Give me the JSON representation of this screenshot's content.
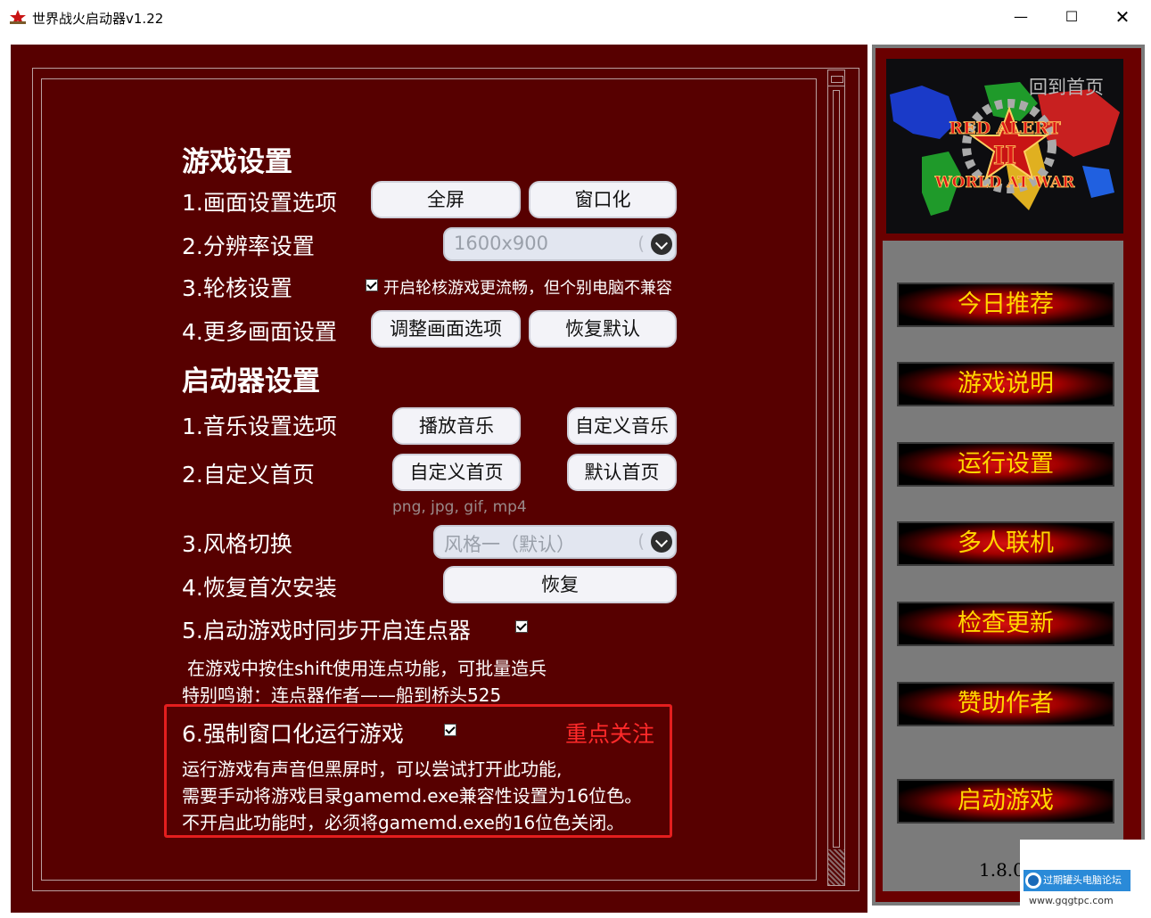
{
  "window": {
    "title": "世界战火启动器v1.22",
    "minimize": "—",
    "maximize": "☐",
    "close": "✕"
  },
  "game_settings": {
    "heading": "游戏设置",
    "display": {
      "label": "1.画面设置选项",
      "fullscreen": "全屏",
      "windowed": "窗口化"
    },
    "resolution": {
      "label": "2.分辨率设置",
      "value": "1600x900",
      "bracket": "("
    },
    "wheel": {
      "label": "3.轮核设置",
      "checkbox_text": "开启轮核游戏更流畅，但个别电脑不兼容",
      "checked": true
    },
    "more": {
      "label": "4.更多画面设置",
      "adjust": "调整画面选项",
      "restore_default": "恢复默认"
    }
  },
  "launcher_settings": {
    "heading": "启动器设置",
    "music": {
      "label": "1.音乐设置选项",
      "play": "播放音乐",
      "custom": "自定义音乐"
    },
    "homepage": {
      "label": "2.自定义首页",
      "custom": "自定义首页",
      "default": "默认首页",
      "formats": "png, jpg, gif, mp4"
    },
    "style": {
      "label": "3.风格切换",
      "value": "风格一（默认）",
      "bracket": "("
    },
    "reinstall": {
      "label": "4.恢复首次安装",
      "button": "恢复"
    },
    "autoclicker": {
      "label": "5.启动游戏时同步开启连点器",
      "checked": true,
      "note1": "在游戏中按住shift使用连点功能，可批量造兵",
      "note2": "特别鸣谢：连点器作者——船到桥头525"
    },
    "force_window": {
      "label": "6.强制窗口化运行游戏",
      "checked": true,
      "highlight": "重点关注",
      "line1": "运行游戏有声音但黑屏时，可以尝试打开此功能,",
      "line2": "需要手动将游戏目录gamemd.exe兼容性设置为16位色。",
      "line3": "不开启此功能时，必须将gamemd.exe的16位色关闭。"
    }
  },
  "sidebar": {
    "banner_text": {
      "title1": "RED ALERT",
      "title2": "II",
      "title3": "WORLD AT WAR"
    },
    "home": "回到首页",
    "buttons": [
      "今日推荐",
      "游戏说明",
      "运行设置",
      "多人联机",
      "检查更新",
      "赞助作者",
      "启动游戏"
    ],
    "version": "1.8.0"
  },
  "watermark": {
    "name": "过期罐头电脑论坛",
    "url": "www.gqgtpc.com"
  },
  "colors": {
    "panel": "#570000",
    "accent_red": "#e41e1e",
    "gold": "#ffd700"
  }
}
